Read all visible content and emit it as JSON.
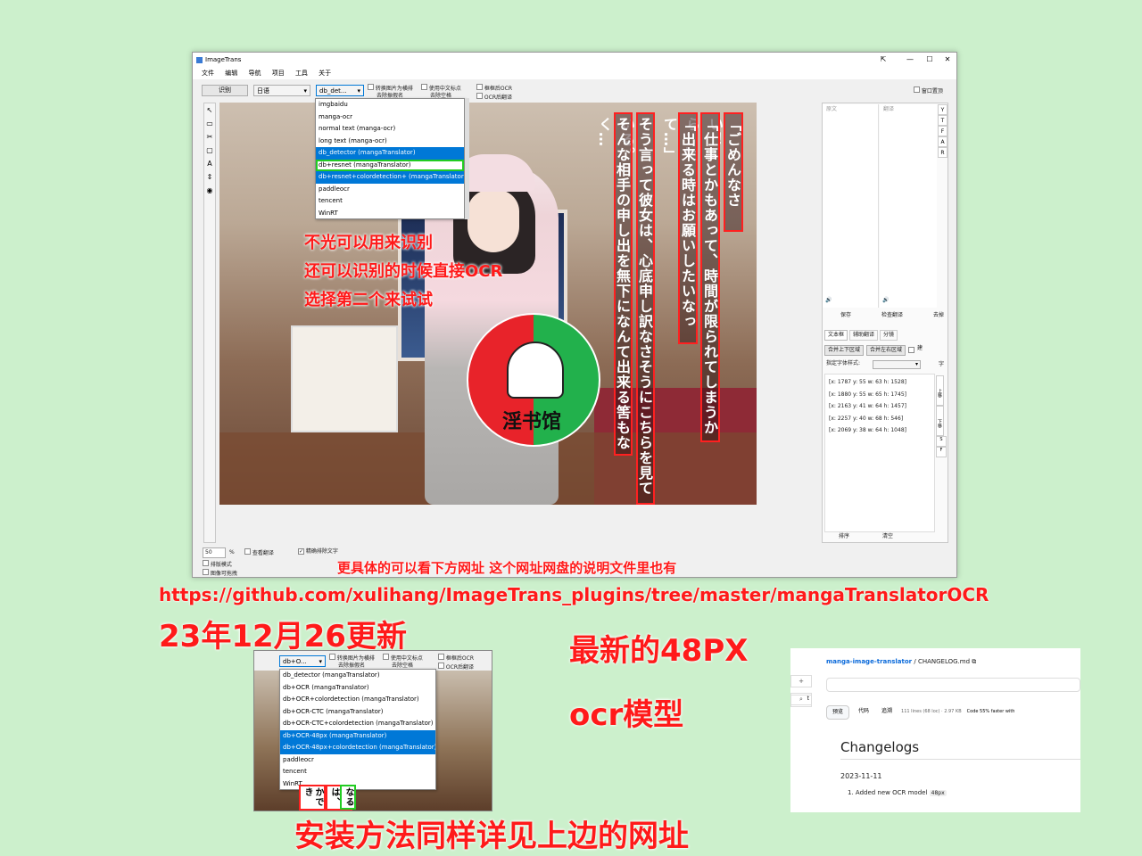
{
  "window": {
    "title": "ImageTrans",
    "controls": [
      "⇱",
      "—",
      "☐",
      "✕"
    ],
    "menu": [
      "文件",
      "编辑",
      "导航",
      "项目",
      "工具",
      "关于"
    ],
    "toolbar": {
      "recognize_label": "识别",
      "language_value": "日语",
      "engine_value": "db_det...",
      "options": [
        "转换图片为横排",
        "去除振假名",
        "使用中文标点",
        "去除空格",
        "框框后OCR",
        "OCR后翻译"
      ],
      "window_top": "窗口置顶"
    },
    "engine_dropdown": [
      "imgbaidu",
      "manga-ocr",
      "normal text (manga-ocr)",
      "long text (manga-ocr)",
      "db_detector (mangaTranslator)",
      "db+resnet (mangaTranslator)",
      "db+resnet+colordetection+ (mangaTranslator)",
      "paddleocr",
      "tencent",
      "WinRT"
    ],
    "left_tools": [
      "↖",
      "▭",
      "✂",
      "▢",
      "A",
      "⇕",
      "◉"
    ],
    "vertical_texts": [
      "「ごめんなさい！",
      "「仕事とかもあって、時間が限られてしまうから…」",
      "「出来る時はお願いしたいなって…」",
      "そう言って彼女は、心底申し訳なさそうにこちらを見ている。",
      "そんな相手の申し出を無下になんて出来る筈もなく…"
    ],
    "logo_text": "淫书馆",
    "right_panel": {
      "col_source": "原文",
      "col_target": "翻译",
      "side_letters": [
        "Y",
        "T",
        "F",
        "A",
        "R"
      ],
      "speaker": "🔊",
      "buttons": [
        "保存",
        "检查翻译",
        "去掉"
      ],
      "tabs": [
        "文本框",
        "辅助翻译",
        "分镜"
      ],
      "merge_buttons": [
        "合并上下区域",
        "合并左右区域",
        "建"
      ],
      "font_style_label": "指定字体样式:",
      "font_letter": "字",
      "regions": [
        "[x: 1787 y: 55 w: 63 h: 1528]",
        "[x: 1880 y: 55 w: 65 h: 1745]",
        "[x: 2163 y: 41 w: 64 h: 1457]",
        "[x: 2257 y: 40 w: 68 h: 546]",
        "[x: 2069 y: 38 w: 64 h: 1048]"
      ],
      "side_buttons": [
        "上移",
        "下移",
        "S",
        "F"
      ],
      "bottom_buttons": [
        "排序",
        "清空"
      ]
    },
    "status": {
      "zoom": "50",
      "percent": "%",
      "view_translation": "查看翻译",
      "precise_exclude": "精确排除文字",
      "layout_mode": "排版模式",
      "image_replaceable": "图像可拖拽"
    }
  },
  "annotations": {
    "line1": "不光可以用来识别",
    "line2": "还可以识别的时候直接OCR",
    "line3": "选择第二个来试试",
    "detail": "更具体的可以看下方网址 这个网址网盘的说明文件里也有",
    "url": "https://github.com/xulihang/ImageTrans_plugins/tree/master/mangaTranslatorOCR",
    "update": "23年12月26更新",
    "newest": "最新的48PX",
    "ocr_model": "ocr模型",
    "install": "安装方法同样详见上边的网址"
  },
  "second_screenshot": {
    "engine_value": "db+O...",
    "options": [
      "转换图片为横排",
      "去除振假名",
      "使用中文标点",
      "去除空格",
      "框框后OCR",
      "OCR后翻译"
    ],
    "dropdown": [
      "db_detector (mangaTranslator)",
      "db+OCR (mangaTranslator)",
      "db+OCR+colordetection (mangaTranslator)",
      "db+OCR-CTC (mangaTranslator)",
      "db+OCR-CTC+colordetection (mangaTranslator)",
      "db+OCR-48px (mangaTranslator)",
      "db+OCR-48px+colordetection (mangaTranslator)",
      "paddleocr",
      "tencent",
      "WinRT"
    ],
    "vertical_snippets": [
      "かでき",
      "では、",
      "なる"
    ]
  },
  "github": {
    "repo": "manga-image-translator",
    "file": "CHANGELOG.md",
    "tabs": [
      "预览",
      "代码",
      "追溯"
    ],
    "meta": "111 lines (68 loc) · 2.97 KB",
    "code_hint": "Code 55% faster with",
    "heading": "Changelogs",
    "date": "2023-11-11",
    "entry": "1. Added new OCR model",
    "badge": "48px"
  },
  "colors": {
    "background": "#ccf0cc",
    "accent_red": "#ff1a1a",
    "highlight": "#0078d7"
  }
}
